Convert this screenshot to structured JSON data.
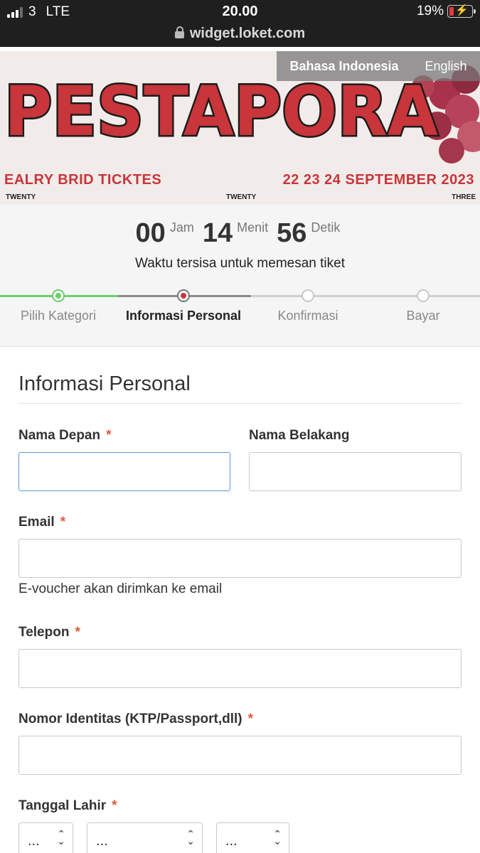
{
  "status_bar": {
    "carrier": "3",
    "network": "LTE",
    "time": "20.00",
    "battery": "19%"
  },
  "browser": {
    "url": "widget.loket.com"
  },
  "banner": {
    "title": "PESTAPORA",
    "left_text": "EALRY BRID TICKTES",
    "right_text": "22 23 24 SEPTEMBER 2023",
    "small_left": "TWENTY",
    "small_mid": "TWENTY",
    "small_right": "THREE"
  },
  "language": {
    "options": [
      "Bahasa Indonesia",
      "English"
    ],
    "active": "Bahasa Indonesia"
  },
  "timer": {
    "hours": "00",
    "hours_unit": "Jam",
    "minutes": "14",
    "minutes_unit": "Menit",
    "seconds": "56",
    "seconds_unit": "Detik",
    "caption": "Waktu tersisa untuk memesan tiket"
  },
  "steps": [
    {
      "label": "Pilih Kategori",
      "state": "done"
    },
    {
      "label": "Informasi Personal",
      "state": "current"
    },
    {
      "label": "Konfirmasi",
      "state": "pending"
    },
    {
      "label": "Bayar",
      "state": "pending"
    }
  ],
  "form": {
    "section_title": "Informasi Personal",
    "required_mark": "*",
    "first_name": {
      "label": "Nama Depan",
      "value": ""
    },
    "last_name": {
      "label": "Nama Belakang",
      "value": ""
    },
    "email": {
      "label": "Email",
      "value": "",
      "helper": "E-voucher akan dirimkan ke email"
    },
    "phone": {
      "label": "Telepon",
      "value": ""
    },
    "id_number": {
      "label": "Nomor Identitas (KTP/Passport,dll)",
      "value": ""
    },
    "birth_date": {
      "label": "Tanggal Lahir",
      "day": "...",
      "month": "...",
      "year": "..."
    }
  },
  "colors": {
    "accent_red": "#c8353a",
    "step_done": "#6bd06b",
    "focus_border": "#5b98d6",
    "required": "#e05a3a"
  }
}
